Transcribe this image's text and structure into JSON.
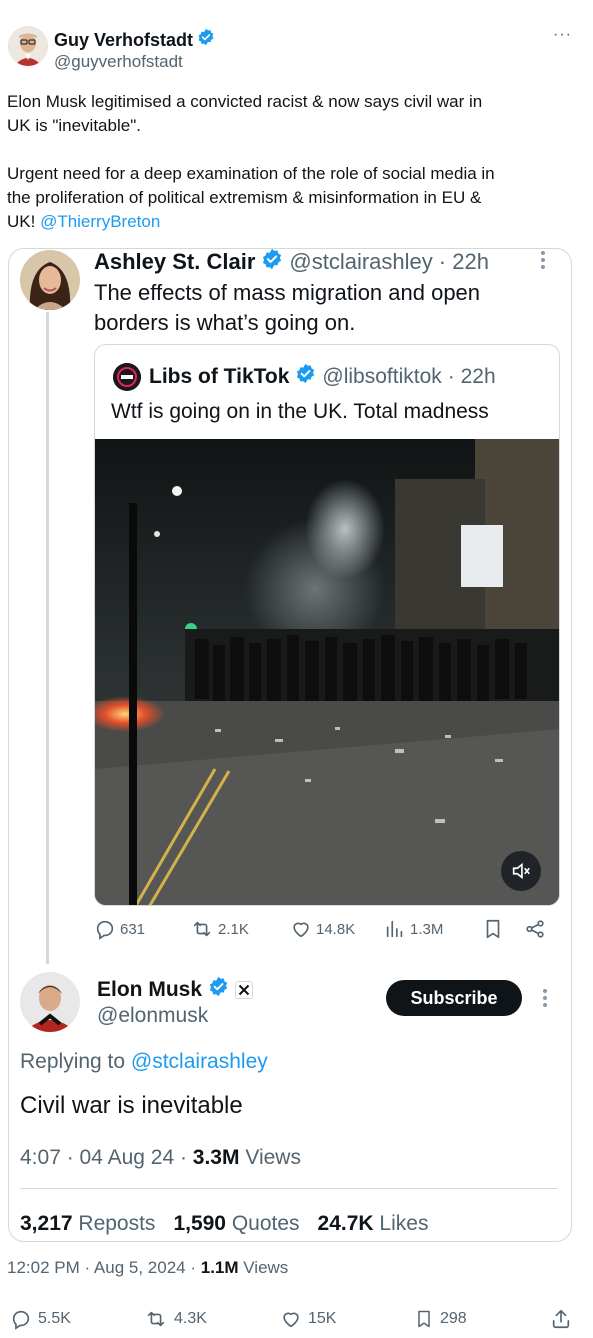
{
  "main_post": {
    "author_name": "Guy Verhofstadt",
    "author_handle": "@guyverhofstadt",
    "more": "···",
    "text_line1": "Elon Musk legitimised a convicted racist & now says civil war in",
    "text_line2": "UK is \"inevitable\".",
    "text_line3": "Urgent need for a deep examination of the role of social media in",
    "text_line4": "the proliferation of political extremism & misinformation in EU &",
    "text_line5_prefix": "UK! ",
    "mention": "@ThierryBreton",
    "timestamp": "12:02 PM · Aug 5, 2024 · ",
    "views_count": "1.1M",
    "views_label": " Views",
    "stats": {
      "replies": "5.5K",
      "reposts": "4.3K",
      "likes": "15K",
      "bookmarks": "298"
    }
  },
  "quoted_post": {
    "author_name": "Ashley St. Clair",
    "author_handle": "@stclairashley",
    "age": "· 22h",
    "text_line1": "The effects of mass migration and open",
    "text_line2": "borders is what’s going on.",
    "stats": {
      "replies": "631",
      "reposts": "2.1K",
      "likes": "14.8K",
      "views": "1.3M"
    }
  },
  "nested_quote": {
    "author_name": "Libs of TikTok",
    "author_handle": "@libsoftiktok",
    "age": "· 22h",
    "text": "Wtf is going on in the UK. Total madness"
  },
  "reply_post": {
    "author_name": "Elon Musk",
    "author_handle": "@elonmusk",
    "subscribe_label": "Subscribe",
    "replying_prefix": "Replying to ",
    "replying_to": "@stclairashley",
    "text": "Civil war is inevitable",
    "time": "4:07 · 04 Aug 24 · ",
    "views_count": "3.3M",
    "views_label": " Views",
    "reposts_count": "3,217",
    "reposts_label": " Reposts",
    "quotes_count": "1,590",
    "quotes_label": " Quotes",
    "likes_count": "24.7K",
    "likes_label": " Likes"
  },
  "colors": {
    "verified": "#1d9bf0",
    "link": "#1d9bf0",
    "muted": "#536471",
    "border": "#cfd9de"
  }
}
